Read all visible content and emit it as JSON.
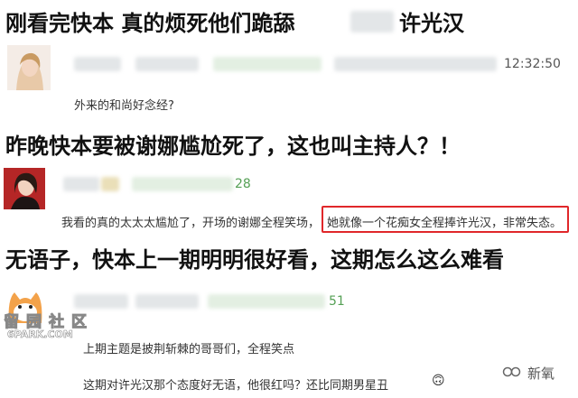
{
  "headlines": {
    "h1": "刚看完快本 真的烦死他们跪舔",
    "h1_tail": "许光汉",
    "h2": "昨晚快本要被谢娜尴尬死了，这也叫主持人？！",
    "h3": "无语子，快本上一期明明很好看，这期怎么这么难看"
  },
  "post1": {
    "time": "12:32:50",
    "comment": "外来的和尚好念经?"
  },
  "post2": {
    "count": "28",
    "comment_a": "我看的真的太太太尴尬了，开场的谢娜全程笑场，",
    "comment_b": "她就像一个花痴女全程捧许光汉，非常失态。"
  },
  "post3": {
    "count": "51",
    "comment_1": "上期主题是披荆斩棘的哥哥们，全程笑点",
    "comment_2": "这期对许光汉那个态度好无语，他很红吗？还比同期男星丑",
    "emoji": "🙃"
  },
  "watermark": {
    "site": "留园社区",
    "url": "6PARK.COM"
  },
  "branding": {
    "name": "新氧"
  },
  "colors": {
    "highlight": "#e0272a",
    "count_green": "#55a055"
  }
}
